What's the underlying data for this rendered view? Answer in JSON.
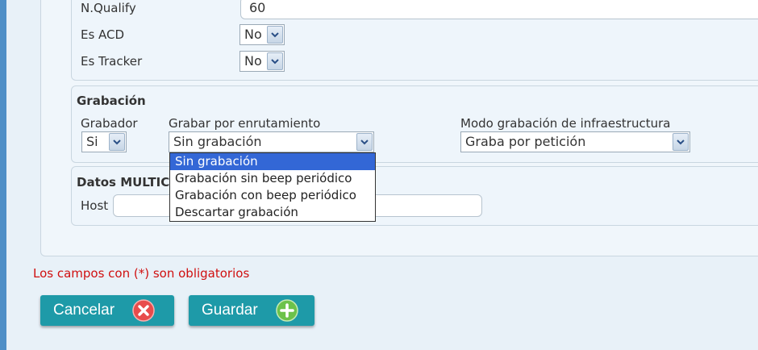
{
  "form": {
    "nqualify": {
      "label": "N.Qualify",
      "value": "60"
    },
    "es_acd": {
      "label": "Es ACD",
      "value": "No"
    },
    "es_tracker": {
      "label": "Es Tracker",
      "value": "No"
    }
  },
  "grabacion": {
    "legend": "Grabación",
    "grabador": {
      "label": "Grabador",
      "value": "Si"
    },
    "enrutamiento": {
      "label": "Grabar por enrutamiento",
      "value": "Sin grabación",
      "options": [
        "Sin grabación",
        "Grabación sin beep periódico",
        "Grabación con beep periódico",
        "Descartar grabación"
      ],
      "selected_index": 0
    },
    "infraestructura": {
      "label": "Modo grabación de infraestructura",
      "value": "Graba por petición"
    }
  },
  "datos": {
    "legend": "Datos MULTIC",
    "host_label": "Host"
  },
  "required_note": "Los campos con (*) son obligatorios",
  "buttons": {
    "cancel": "Cancelar",
    "save": "Guardar"
  },
  "colors": {
    "button_bg": "#1e9aa8",
    "cancel_icon": "#e84c4c",
    "save_icon": "#6cc24a",
    "required_text": "#d01010",
    "option_highlight": "#3367d6"
  },
  "icons": {
    "cancel": "close-circle-icon",
    "save": "plus-circle-icon",
    "select_arrow": "chevron-down-icon"
  }
}
